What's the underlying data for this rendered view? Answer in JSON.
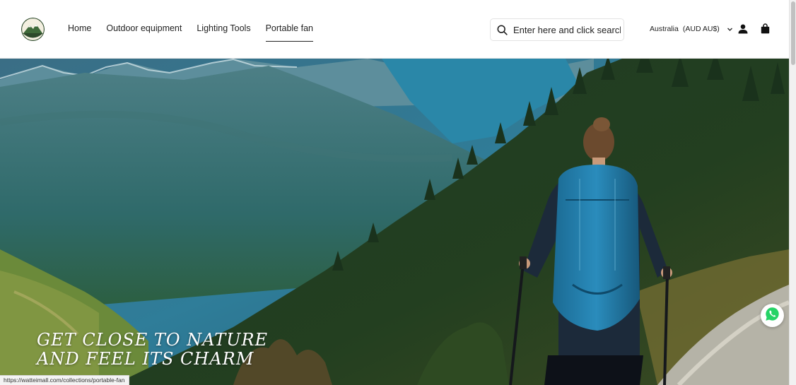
{
  "brand": {
    "logo_icon": "mountain-logo-icon"
  },
  "nav": {
    "items": [
      {
        "label": "Home",
        "active": false
      },
      {
        "label": "Outdoor equipment",
        "active": false
      },
      {
        "label": "Lighting Tools",
        "active": false
      },
      {
        "label": "Portable fan",
        "active": true
      }
    ]
  },
  "search": {
    "placeholder": "Enter here and click search",
    "icon": "search-icon"
  },
  "locale": {
    "country": "Australia",
    "currency": "(AUD AU$)"
  },
  "account": {
    "icon": "user-icon"
  },
  "cart": {
    "icon": "shopping-bag-icon"
  },
  "hero": {
    "title_line1": "GET CLOSE TO NATURE",
    "title_line2": "AND FEEL ITS CHARM"
  },
  "chat": {
    "icon": "whatsapp-icon",
    "color": "#25D366"
  },
  "status_bar": {
    "url": "https://watteimall.com/collections/portable-fan"
  },
  "colors": {
    "text": "#222222",
    "accent_bag": "#b3362a"
  }
}
